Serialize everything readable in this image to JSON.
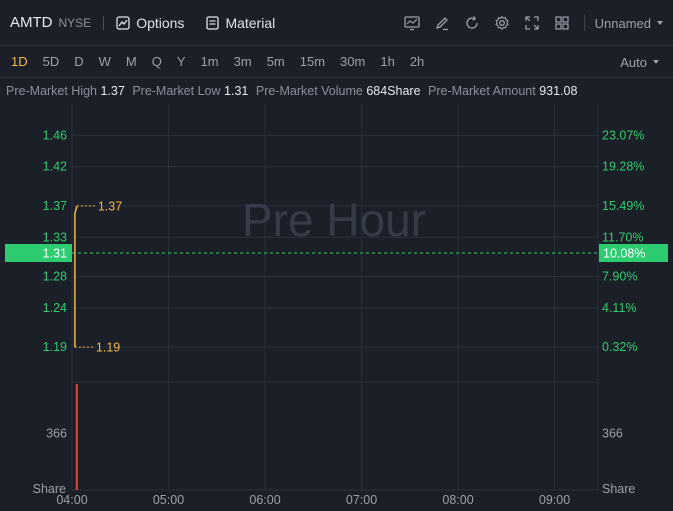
{
  "header": {
    "symbol": "AMTD",
    "exchange": "NYSE",
    "options_label": "Options",
    "material_label": "Material",
    "layout_label": "Unnamed",
    "icons": [
      "chart-icon",
      "pen-icon",
      "refresh-icon",
      "gear-icon",
      "fullscreen-icon",
      "grid-icon"
    ]
  },
  "timeframes": {
    "items": [
      "1D",
      "5D",
      "D",
      "W",
      "M",
      "Q",
      "Y",
      "1m",
      "3m",
      "5m",
      "15m",
      "30m",
      "1h",
      "2h"
    ],
    "active": "1D",
    "mode_label": "Auto"
  },
  "stats": {
    "high_label": "Pre-Market High",
    "high_value": "1.37",
    "low_label": "Pre-Market Low",
    "low_value": "1.31",
    "volume_label": "Pre-Market Volume",
    "volume_value": "684Share",
    "amount_label": "Pre-Market Amount",
    "amount_value": "931.08"
  },
  "colors": {
    "up": "#2ecc71",
    "price_line": "#f5b840",
    "volume_bar": "#e0483e",
    "grid": "#2a303b",
    "watermark": "#353b47"
  },
  "chart_data": {
    "type": "line",
    "watermark": "Pre Hour",
    "x_ticks": [
      "04:00",
      "05:00",
      "06:00",
      "07:00",
      "08:00",
      "09:00"
    ],
    "xlim": [
      0,
      5.45
    ],
    "price_ticks": [
      {
        "label": "1.46",
        "value": 1.46
      },
      {
        "label": "1.42",
        "value": 1.42
      },
      {
        "label": "1.37",
        "value": 1.37
      },
      {
        "label": "1.33",
        "value": 1.33
      },
      {
        "label": "1.28",
        "value": 1.28
      },
      {
        "label": "1.24",
        "value": 1.24
      },
      {
        "label": "1.19",
        "value": 1.19
      }
    ],
    "pct_ticks": [
      {
        "label": "23.07%",
        "value": 1.46
      },
      {
        "label": "19.28%",
        "value": 1.42
      },
      {
        "label": "15.49%",
        "value": 1.37
      },
      {
        "label": "11.70%",
        "value": 1.33
      },
      {
        "label": "7.90%",
        "value": 1.28
      },
      {
        "label": "4.11%",
        "value": 1.24
      },
      {
        "label": "0.32%",
        "value": 1.19
      }
    ],
    "ylim": [
      1.148,
      1.5
    ],
    "current_price": {
      "value": 1.31,
      "label": "1.31",
      "pct_label": "10.08%"
    },
    "price_series": [
      {
        "x": 0.03,
        "y": 1.19
      },
      {
        "x": 0.03,
        "y": 1.36
      },
      {
        "x": 0.05,
        "y": 1.37
      }
    ],
    "high_marker": {
      "label": "1.37",
      "value": 1.37
    },
    "low_marker": {
      "label": "1.19",
      "value": 1.19
    },
    "volume": {
      "ticks_left": [
        {
          "label": "366",
          "value": 366
        }
      ],
      "ticks_right": [
        {
          "label": "366",
          "value": 366
        }
      ],
      "unit_left": "Share",
      "unit_right": "Share",
      "ylim": [
        0,
        684
      ],
      "bars": [
        {
          "x": 0.05,
          "value": 684
        }
      ]
    }
  }
}
